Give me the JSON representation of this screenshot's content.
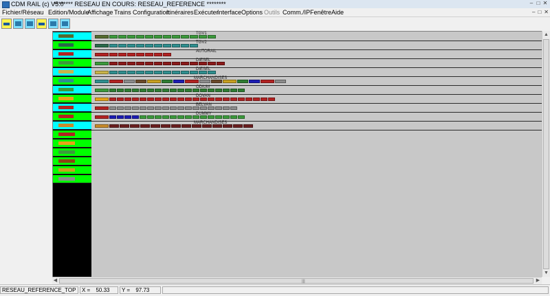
{
  "window": {
    "app_title": "CDM RAIL (c) V5.0",
    "network_title": "******** RESEAU EN COURS: RESEAU_REFERENCE ********"
  },
  "menu": [
    {
      "label": "Fichier/Réseau",
      "enabled": true
    },
    {
      "label": "Edition/Module",
      "enabled": true
    },
    {
      "label": "Affichage",
      "enabled": true
    },
    {
      "label": "Trains",
      "enabled": true
    },
    {
      "label": "Configuration",
      "enabled": true
    },
    {
      "label": "Itinéraires",
      "enabled": true
    },
    {
      "label": "Exécuter",
      "enabled": true
    },
    {
      "label": "Interface",
      "enabled": true
    },
    {
      "label": "Options",
      "enabled": true
    },
    {
      "label": "Outils",
      "enabled": false
    },
    {
      "label": "Comm./IP",
      "enabled": true
    },
    {
      "label": "Fenêtre",
      "enabled": true
    },
    {
      "label": "Aide",
      "enabled": true
    }
  ],
  "toolbar": {
    "buttons": [
      "loco-icon",
      "railcar-icon",
      "railcar-icon",
      "wagon-icon",
      "railcar-icon",
      "railcar-icon"
    ]
  },
  "palette": {
    "cyan": "#00ffff",
    "green": "#00ff00",
    "black": "#000000",
    "train_green": "#3c9a3c",
    "train_dark_green": "#2e7d32",
    "train_red": "#b22222",
    "train_dark_red": "#8b1a1a",
    "train_grey": "#8c8c8c",
    "train_teal": "#2f8f8f",
    "train_brown": "#6b1f1f",
    "train_blue": "#1c1cb4"
  },
  "train_rows": [
    {
      "name": "TGV1",
      "stock_color": "#3c9a3c",
      "cars": 12,
      "icon_color": "#556b2f"
    },
    {
      "name": "TGV2",
      "stock_color": "#2f8f8f",
      "cars": 10,
      "icon_color": "#2a6a4a"
    },
    {
      "name": "AUTORAIL",
      "stock_color": "#b22222",
      "cars": 7,
      "icon_color": "#b22222"
    },
    {
      "name": "DIESEL",
      "stock_color": "#8b1a1a",
      "cars": 13,
      "icon_color": "#3c9a3c"
    },
    {
      "name": "DIESEL",
      "stock_color": "#2f8f8f",
      "cars": 12,
      "icon_color": "#c8b44a"
    },
    {
      "name": "MARCHANDISES",
      "stock_color": "#6b4a2a",
      "cars": 14,
      "icon_color": "#2f8f8f"
    },
    {
      "name": "ODIUM",
      "stock_color": "#2e7d32",
      "cars": 18,
      "icon_color": "#3c9a3c"
    },
    {
      "name": "DOVAN",
      "stock_color": "#b22222",
      "cars": 22,
      "icon_color": "#e8a317"
    },
    {
      "name": "BELVAN",
      "stock_color": "#8c8c8c",
      "cars": 17,
      "icon_color": "#b22222"
    },
    {
      "name": "DUMMY",
      "stock_color": "#3c9a3c",
      "cars": 18,
      "icon_color": "#b22222"
    },
    {
      "name": "MARCHANDISES",
      "stock_color": "#6b1f1f",
      "cars": 14,
      "icon_color": "#c88a2a"
    }
  ],
  "stock_catalog": [
    {
      "type": "wagon",
      "color": "#b22222"
    },
    {
      "type": "wagon",
      "color": "#e8a317"
    },
    {
      "type": "wagon",
      "color": "#3c9a3c"
    },
    {
      "type": "wagon",
      "color": "#8b4513"
    },
    {
      "type": "wagon",
      "color": "#c8a020"
    },
    {
      "type": "wagon",
      "color": "#8c8c8c"
    }
  ],
  "status": {
    "network": "RESEAU_REFERENCE_TOP",
    "x_label": "X =",
    "x_value": "50.33",
    "y_label": "Y =",
    "y_value": "97.73"
  }
}
